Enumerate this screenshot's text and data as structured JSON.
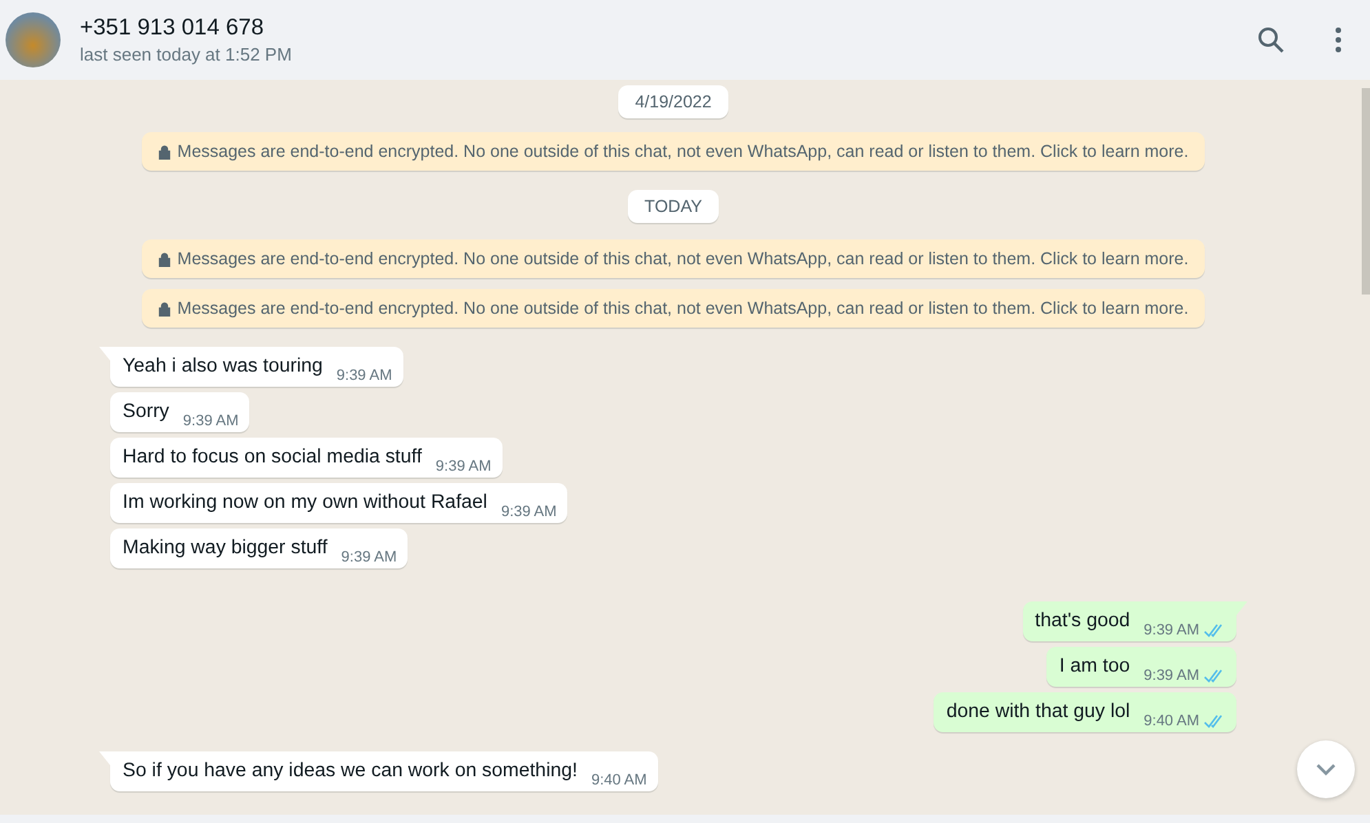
{
  "header": {
    "title": "+351 913 014 678",
    "subtitle": "last seen today at 1:52 PM"
  },
  "messages": [
    {
      "kind": "date",
      "text": "4/19/2022"
    },
    {
      "kind": "notice",
      "text": "Messages are end-to-end encrypted. No one outside of this chat, not even WhatsApp, can read or listen to them. Click to learn more."
    },
    {
      "kind": "date",
      "text": "TODAY"
    },
    {
      "kind": "notice",
      "text": "Messages are end-to-end encrypted. No one outside of this chat, not even WhatsApp, can read or listen to them. Click to learn more."
    },
    {
      "kind": "notice",
      "text": "Messages are end-to-end encrypted. No one outside of this chat, not even WhatsApp, can read or listen to them. Click to learn more."
    },
    {
      "kind": "incoming",
      "text": "Yeah i also was touring",
      "time": "9:39 AM",
      "tail": true
    },
    {
      "kind": "incoming",
      "text": "Sorry",
      "time": "9:39 AM",
      "tail": false
    },
    {
      "kind": "incoming",
      "text": "Hard to focus on social media stuff",
      "time": "9:39 AM",
      "tail": false
    },
    {
      "kind": "incoming",
      "text": "Im working now on my own without Rafael",
      "time": "9:39 AM",
      "tail": false
    },
    {
      "kind": "incoming",
      "text": "Making way bigger stuff",
      "time": "9:39 AM",
      "tail": false
    },
    {
      "kind": "outgoing",
      "text": "that's good",
      "time": "9:39 AM",
      "tail": true,
      "read": true
    },
    {
      "kind": "outgoing",
      "text": "I am too",
      "time": "9:39 AM",
      "tail": false,
      "read": true
    },
    {
      "kind": "outgoing",
      "text": "done with that guy lol",
      "time": "9:40 AM",
      "tail": false,
      "read": true
    },
    {
      "kind": "incoming",
      "text": "So if you have any ideas we can work on something!",
      "time": "9:40 AM",
      "tail": true
    }
  ]
}
